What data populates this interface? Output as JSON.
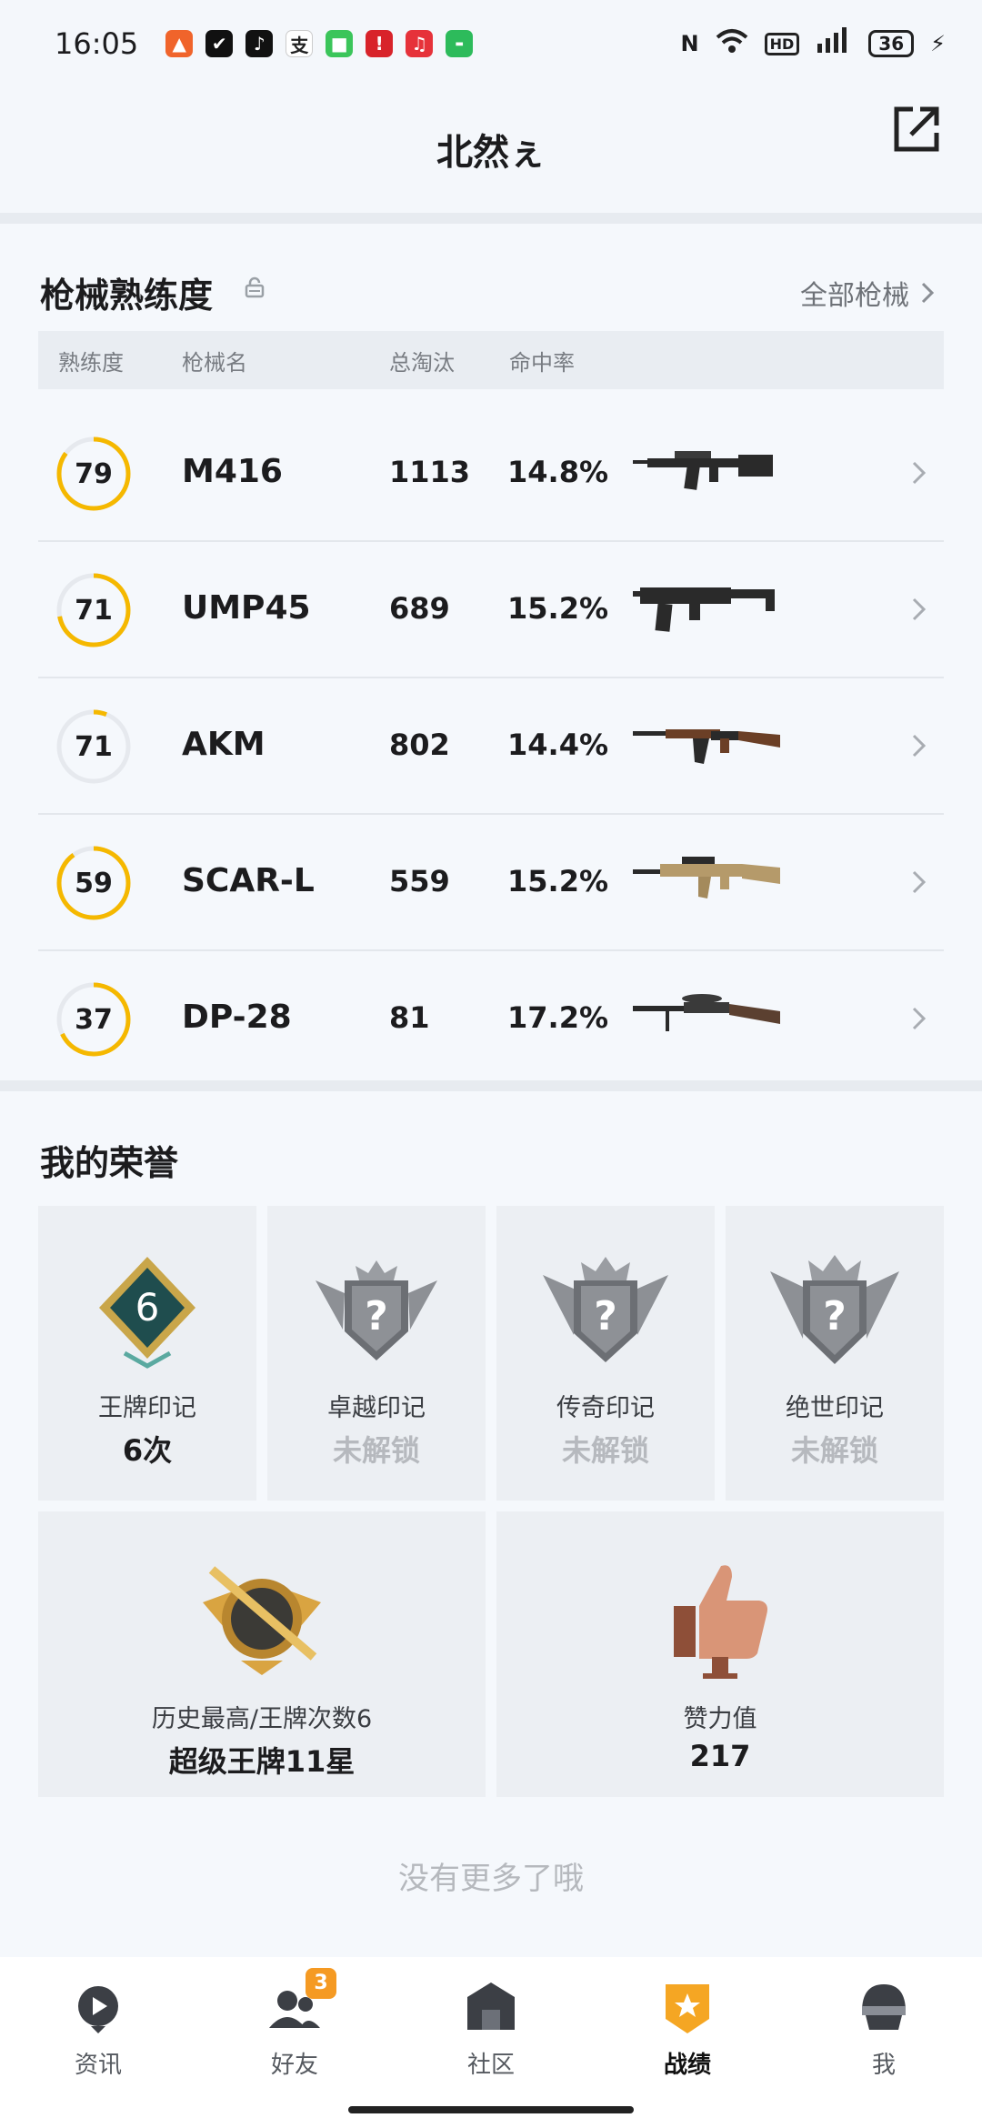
{
  "status": {
    "time": "16:05",
    "battery": "36",
    "network": "4G"
  },
  "header": {
    "title": "北然ぇ"
  },
  "gun_section": {
    "title": "枪械熟练度",
    "all_link": "全部枪械",
    "columns": [
      "熟练度",
      "枪械名",
      "总淘汰",
      "命中率"
    ],
    "rows": [
      {
        "proficiency": "79",
        "progress": 0.85,
        "name": "M416",
        "kills": "1113",
        "rate": "14.8%"
      },
      {
        "proficiency": "71",
        "progress": 0.72,
        "name": "UMP45",
        "kills": "689",
        "rate": "15.2%"
      },
      {
        "proficiency": "71",
        "progress": 0.06,
        "name": "AKM",
        "kills": "802",
        "rate": "14.4%"
      },
      {
        "proficiency": "59",
        "progress": 0.9,
        "name": "SCAR-L",
        "kills": "559",
        "rate": "15.2%"
      },
      {
        "proficiency": "37",
        "progress": 0.68,
        "name": "DP-28",
        "kills": "81",
        "rate": "17.2%"
      }
    ]
  },
  "honor_section": {
    "title": "我的荣誉",
    "badges": [
      {
        "label": "王牌印记",
        "value": "6次",
        "locked": false,
        "emblem_text": "6"
      },
      {
        "label": "卓越印记",
        "value": "未解锁",
        "locked": true,
        "emblem_text": "?"
      },
      {
        "label": "传奇印记",
        "value": "未解锁",
        "locked": true,
        "emblem_text": "?"
      },
      {
        "label": "绝世印记",
        "value": "未解锁",
        "locked": true,
        "emblem_text": "?"
      }
    ],
    "history": {
      "label": "历史最高/王牌次数6",
      "value": "超级王牌11星"
    },
    "likes": {
      "label": "赞力值",
      "value": "217"
    }
  },
  "footer_text": "没有更多了哦",
  "tabs": [
    {
      "label": "资讯",
      "icon": "news-icon"
    },
    {
      "label": "好友",
      "icon": "friends-icon",
      "badge": "3"
    },
    {
      "label": "社区",
      "icon": "community-icon"
    },
    {
      "label": "战绩",
      "icon": "record-icon",
      "active": true
    },
    {
      "label": "我",
      "icon": "profile-icon"
    }
  ],
  "colors": {
    "accent": "#f5b800",
    "track": "#e6e9ee"
  }
}
